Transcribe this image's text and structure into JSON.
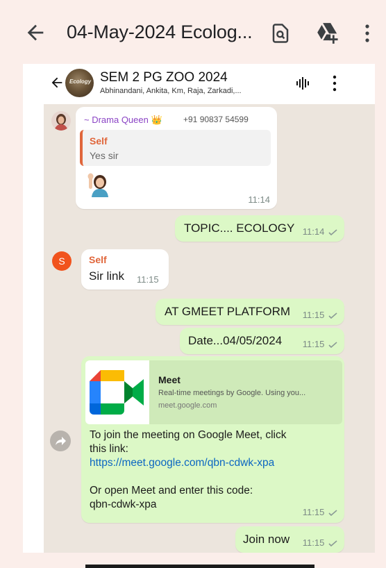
{
  "viewer": {
    "title": "04-May-2024 Ecolog...",
    "icons": [
      "back-arrow-icon",
      "find-in-page-icon",
      "add-to-drive-icon",
      "more-vert-icon"
    ]
  },
  "chat": {
    "name": "SEM 2 PG ZOO 2024",
    "members": "Abhinandani, Ankita, Km, Raja, Zarkadi,...",
    "avatar_label": "Ecology"
  },
  "messages": {
    "m1": {
      "sender": "~ Drama Queen 👑",
      "phone": "+91 90837 54599",
      "quote_name": "Self",
      "quote_text": "Yes sir",
      "time": "11:14"
    },
    "m2": {
      "text": "TOPIC.... ECOLOGY",
      "time": "11:14"
    },
    "m3": {
      "avatar_letter": "S",
      "sender": "Self",
      "text": "Sir link",
      "time": "11:15"
    },
    "m4": {
      "text": "AT GMEET PLATFORM",
      "time": "11:15"
    },
    "m5": {
      "text": "Date...04/05/2024",
      "time": "11:15"
    },
    "m6": {
      "preview_title": "Meet",
      "preview_desc": "Real-time meetings by Google. Using you...",
      "preview_domain": "meet.google.com",
      "line1": "To join the meeting on Google Meet, click",
      "line2": "this link:",
      "link": "https://meet.google.com/qbn-cdwk-xpa",
      "line3": "Or open Meet and enter this code:",
      "code": "qbn-cdwk-xpa",
      "time": "11:15"
    },
    "m7": {
      "text": "Join now",
      "time": "11:15"
    }
  },
  "colors": {
    "chat_background": "#ece5dd",
    "outgoing_bubble": "#dcf8c6",
    "incoming_bubble": "#ffffff",
    "sender_purple": "#8b44c5",
    "self_orange": "#e0663b",
    "link_blue": "#0b66c2",
    "viewer_background": "#fbeeea"
  }
}
